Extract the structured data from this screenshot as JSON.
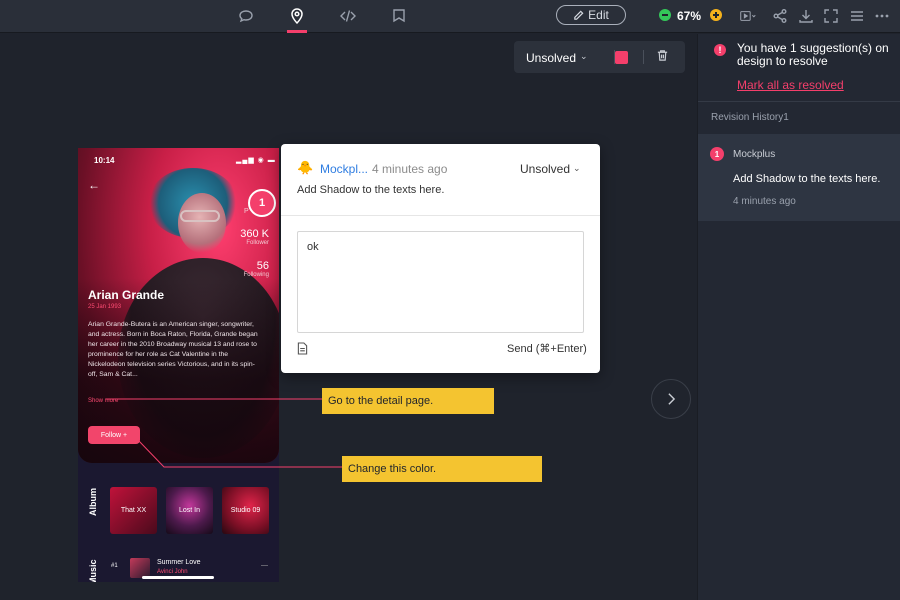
{
  "toolbar": {
    "edit_label": "Edit",
    "zoom_value": "67%",
    "tools": [
      "comment-icon",
      "pin-icon",
      "code-icon",
      "bookmark-icon"
    ],
    "right_icons": [
      "play-icon",
      "share-icon",
      "download-icon",
      "fullscreen-icon",
      "menu-icon",
      "more-icon"
    ]
  },
  "status_tool": {
    "status_label": "Unsolved",
    "color": "#f43f6b"
  },
  "phone": {
    "time": "10:14",
    "stats": [
      {
        "num": "360 K",
        "label": "Follower"
      },
      {
        "num": "56",
        "label": "Following"
      }
    ],
    "partial_label": "P",
    "name": "Arian Grande",
    "date": "25 Jan 1993",
    "bio": "Arian Grande-Butera is an American singer, songwriter, and actress. Born in Boca Raton, Florida, Grande began her career in the 2010 Broadway musical 13 and rose to prominence for her role as Cat Valentine in the Nickelodeon television series Victorious, and in its spin-off, Sam & Cat...",
    "show_more": "Show more",
    "follow_label": "Follow +",
    "album_label": "Album",
    "albums": [
      "That XX",
      "Lost In",
      "Studio 09"
    ],
    "music_label": "Music",
    "track": {
      "num": "#1",
      "title": "Summer Love",
      "artist": "Avinci John",
      "dash": "—"
    }
  },
  "pin": {
    "number": "1"
  },
  "comment": {
    "author": "Mockpl...",
    "time": "4 minutes ago",
    "status": "Unsolved",
    "text": "Add Shadow to the texts here.",
    "reply_value": "ok",
    "send_label": "Send (⌘+Enter)"
  },
  "notes": [
    {
      "text": "Go to the detail page."
    },
    {
      "text": "Change this color."
    }
  ],
  "right_panel": {
    "alert_text": "You have 1 suggestion(s) on design to resolve",
    "mark_resolved": "Mark all as resolved",
    "history_label": "Revision History1",
    "item": {
      "badge": "1",
      "author": "Mockplus",
      "text": "Add Shadow to the texts here.",
      "time": "4 minutes ago"
    }
  },
  "colors": {
    "accent": "#f43f6b",
    "note": "#f4c430",
    "link": "#2f7de1"
  }
}
